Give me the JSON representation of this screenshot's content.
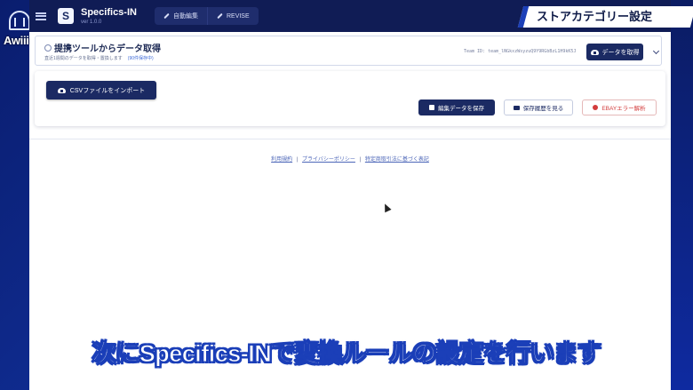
{
  "overlay": {
    "logo_text": "Awiiin",
    "section_title": "ストアカテゴリー設定",
    "subtitle": "次にSpecifics-INで変換ルールの設定を行います"
  },
  "appbar": {
    "logo_letter": "S",
    "title": "Specifics-IN",
    "version": "ver 1.0.0",
    "tabs": [
      {
        "label": "自動編集"
      },
      {
        "label": "REVISE"
      }
    ]
  },
  "fetch_panel": {
    "title": "提携ツールからデータ取得",
    "subtitle": "直近1週間のデータを取得・置換します",
    "subtitle_highlight": "(90件保存中)",
    "team_id": "Team ID: team_lNGkxzWsyzuQ9Y9RGbBzL1H9kK5J",
    "fetch_button": "データを取得"
  },
  "actions": {
    "import_csv": "CSVファイルをインポート",
    "save": "編集データを保存",
    "history": "保存履歴を見る",
    "ebay_error": "EBAYエラー解析"
  },
  "footer": {
    "terms": "利用規約",
    "privacy": "プライバシーポリシー",
    "law": "特定商取引法に基づく表記",
    "separator": "|"
  },
  "colors": {
    "appbar": "#101c55",
    "primary_button": "#1b2a63",
    "danger": "#d33c3c",
    "overlay_blue": "#1b3fb8"
  }
}
